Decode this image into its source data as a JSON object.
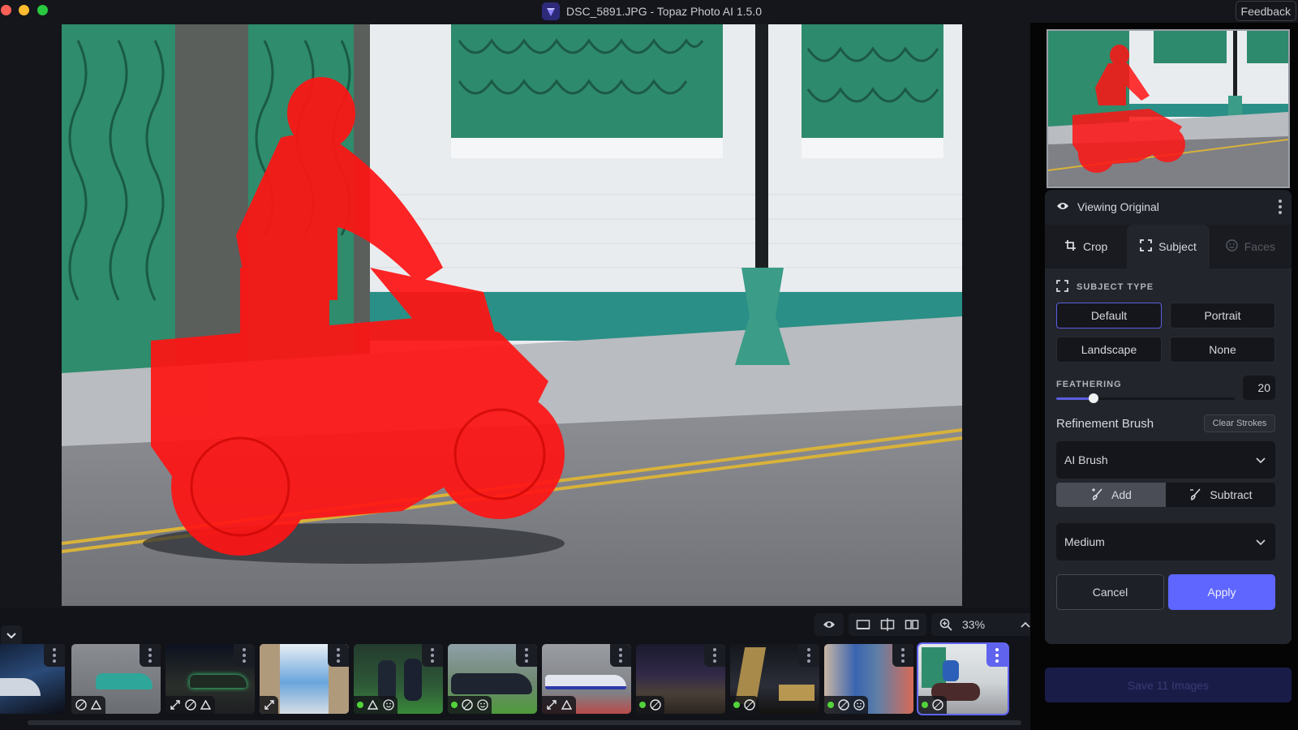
{
  "window": {
    "title": "DSC_5891.JPG - Topaz Photo AI 1.5.0",
    "feedback_label": "Feedback",
    "app_icon": "topaz-gem-icon"
  },
  "colors": {
    "accent": "#5e66ff",
    "accent_outline": "#5b5ee0",
    "mask_overlay": "#ff1a1a",
    "status_ok": "#52d33a"
  },
  "viewer": {
    "image_name": "DSC_5891.JPG",
    "subject_mask": "red overlay on motorcycle rider",
    "zoom_level": "33%",
    "view_tools": [
      "preview-eye-icon",
      "single-view-icon",
      "split-view-icon",
      "side-by-side-icon"
    ],
    "collapse_icon": "chevron-down-icon",
    "expand_icon": "chevron-up-icon"
  },
  "filmstrip": {
    "items": [
      {
        "name": "night-dome-lights",
        "status": false,
        "badges": [
          "triangle"
        ],
        "selected": false
      },
      {
        "name": "race-car-green",
        "status": false,
        "badges": [
          "denoise",
          "triangle"
        ],
        "selected": false
      },
      {
        "name": "race-car-night",
        "status": false,
        "badges": [
          "upscale",
          "denoise",
          "triangle"
        ],
        "selected": false
      },
      {
        "name": "stairway-sky",
        "status": false,
        "badges": [
          "upscale"
        ],
        "selected": false
      },
      {
        "name": "rugby-players",
        "status": true,
        "badges": [
          "triangle",
          "face"
        ],
        "selected": false
      },
      {
        "name": "classic-car-show",
        "status": true,
        "badges": [
          "denoise",
          "face"
        ],
        "selected": false
      },
      {
        "name": "le-mans-prototype",
        "status": false,
        "badges": [
          "upscale",
          "triangle"
        ],
        "selected": false
      },
      {
        "name": "city-skyline-night",
        "status": true,
        "badges": [
          "denoise"
        ],
        "selected": false
      },
      {
        "name": "skyscraper-night",
        "status": true,
        "badges": [
          "denoise"
        ],
        "selected": false
      },
      {
        "name": "street-scene",
        "status": true,
        "badges": [
          "denoise",
          "face"
        ],
        "selected": false
      },
      {
        "name": "motorcycle-rider",
        "status": true,
        "badges": [
          "denoise"
        ],
        "selected": true
      }
    ]
  },
  "panel": {
    "viewing_label": "Viewing Original",
    "tabs": [
      {
        "label": "Crop",
        "icon": "crop-icon",
        "state": "normal"
      },
      {
        "label": "Subject",
        "icon": "subject-frame-icon",
        "state": "active"
      },
      {
        "label": "Faces",
        "icon": "face-icon",
        "state": "disabled"
      }
    ],
    "subject_type": {
      "heading": "SUBJECT TYPE",
      "options": [
        "Default",
        "Portrait",
        "Landscape",
        "None"
      ],
      "selected": "Default"
    },
    "feathering": {
      "label": "FEATHERING",
      "value": "20",
      "fraction": 0.21
    },
    "refinement": {
      "label": "Refinement Brush",
      "clear_label": "Clear Strokes",
      "brush_type": "AI Brush",
      "modes": [
        "Add",
        "Subtract"
      ],
      "active_mode": "Add",
      "size": "Medium"
    },
    "cancel_label": "Cancel",
    "apply_label": "Apply",
    "save_label": "Save 11 Images"
  }
}
